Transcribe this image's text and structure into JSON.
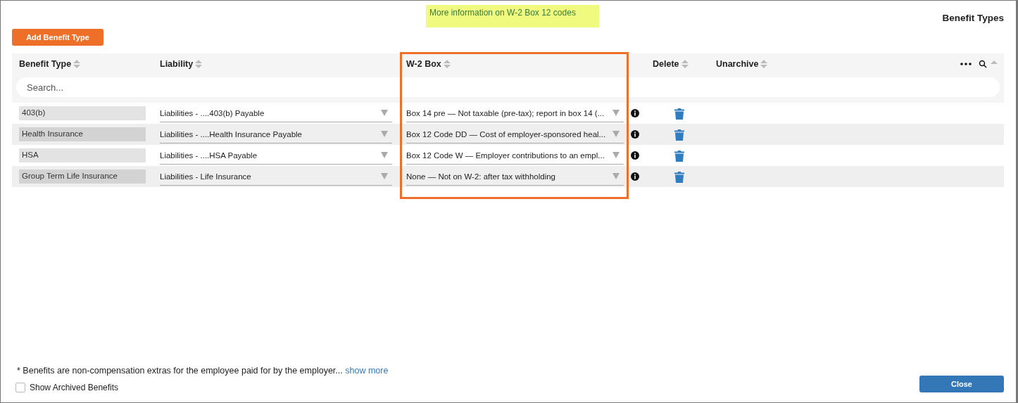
{
  "info_link": "More information on W-2 Box 12 codes",
  "title": "Benefit Types",
  "add_button": "Add Benefit Type",
  "table": {
    "columns": [
      {
        "label": "Benefit Type"
      },
      {
        "label": "Liability"
      },
      {
        "label": "W-2 Box"
      },
      {
        "label": "Delete"
      },
      {
        "label": "Unarchive"
      }
    ],
    "search": {
      "placeholder": "Search..."
    },
    "rows": [
      {
        "benefit_type": "403(b)",
        "liability": "Liabilities - ....403(b) Payable",
        "w2_box": "Box 14 pre — Not taxable (pre-tax); report in box 14 (..."
      },
      {
        "benefit_type": "Health Insurance",
        "liability": "Liabilities - ....Health Insurance Payable",
        "w2_box": "Box 12 Code DD — Cost of employer-sponsored heal..."
      },
      {
        "benefit_type": "HSA",
        "liability": "Liabilities - ....HSA Payable",
        "w2_box": "Box 12 Code W — Employer contributions to an empl..."
      },
      {
        "benefit_type": "Group Term Life Insurance",
        "liability": "Liabilities - Life Insurance",
        "w2_box": "None — Not on W-2: after tax withholding"
      }
    ]
  },
  "note": "* Benefits are non-compensation extras for the employee paid for by the employer...",
  "show_more": "show more",
  "show_archived": {
    "label": "Show Archived Benefits",
    "checked": false
  },
  "close_button": "Close"
}
